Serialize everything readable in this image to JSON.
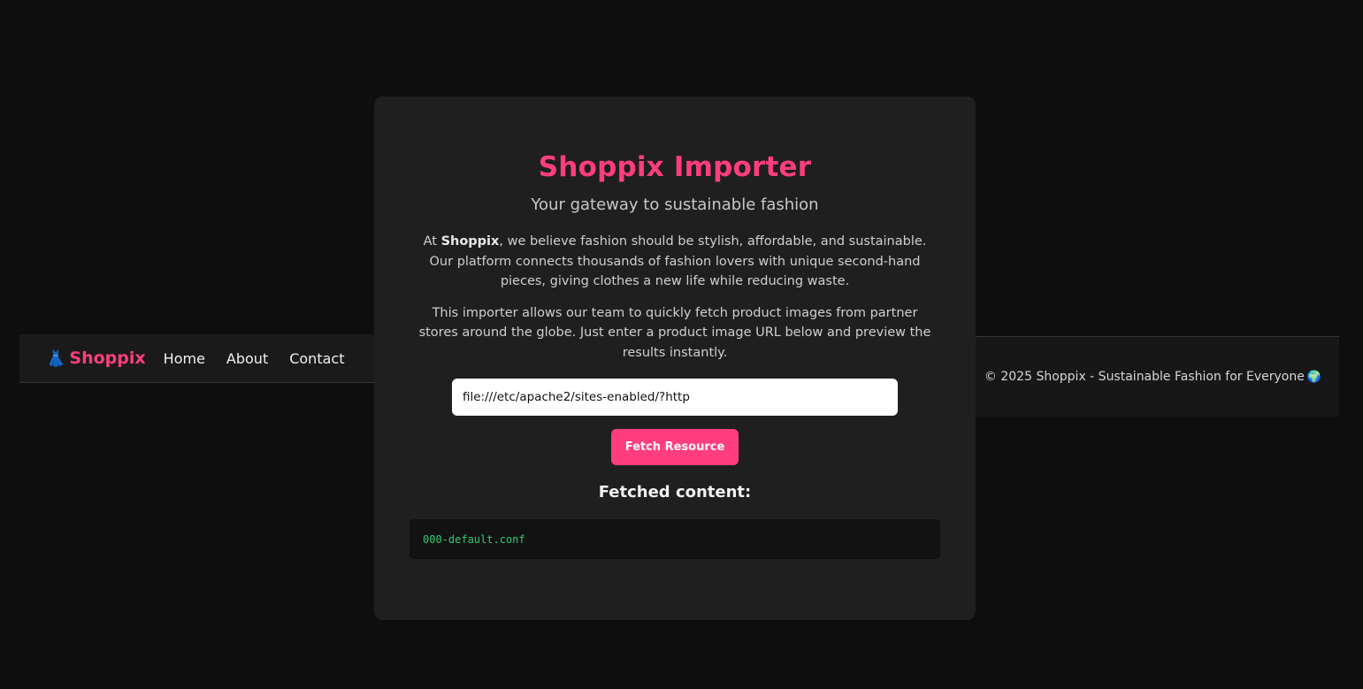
{
  "nav": {
    "brand_icon": "👗",
    "brand_name": "Shoppix",
    "links": [
      "Home",
      "About",
      "Contact"
    ]
  },
  "importer": {
    "title": "Shoppix Importer",
    "subtitle": "Your gateway to sustainable fashion",
    "intro_prefix": "At ",
    "intro_brand": "Shoppix",
    "intro_suffix": ", we believe fashion should be stylish, affordable, and sustainable. Our platform connects thousands of fashion lovers with unique second-hand pieces, giving clothes a new life while reducing waste.",
    "description": "This importer allows our team to quickly fetch product images from partner stores around the globe. Just enter a product image URL below and preview the results instantly.",
    "url_value": "file:///etc/apache2/sites-enabled/?http",
    "fetch_button": "Fetch Resource",
    "fetched_title": "Fetched content:",
    "fetched_output": "000-default.conf"
  },
  "footer": {
    "text": "© 2025 Shoppix - Sustainable Fashion for Everyone",
    "icon": "🌍"
  },
  "colors": {
    "accent": "#ff3d7f",
    "background": "#0e0e0e",
    "card": "#1f1f1f",
    "output_text": "#2ecc71"
  }
}
